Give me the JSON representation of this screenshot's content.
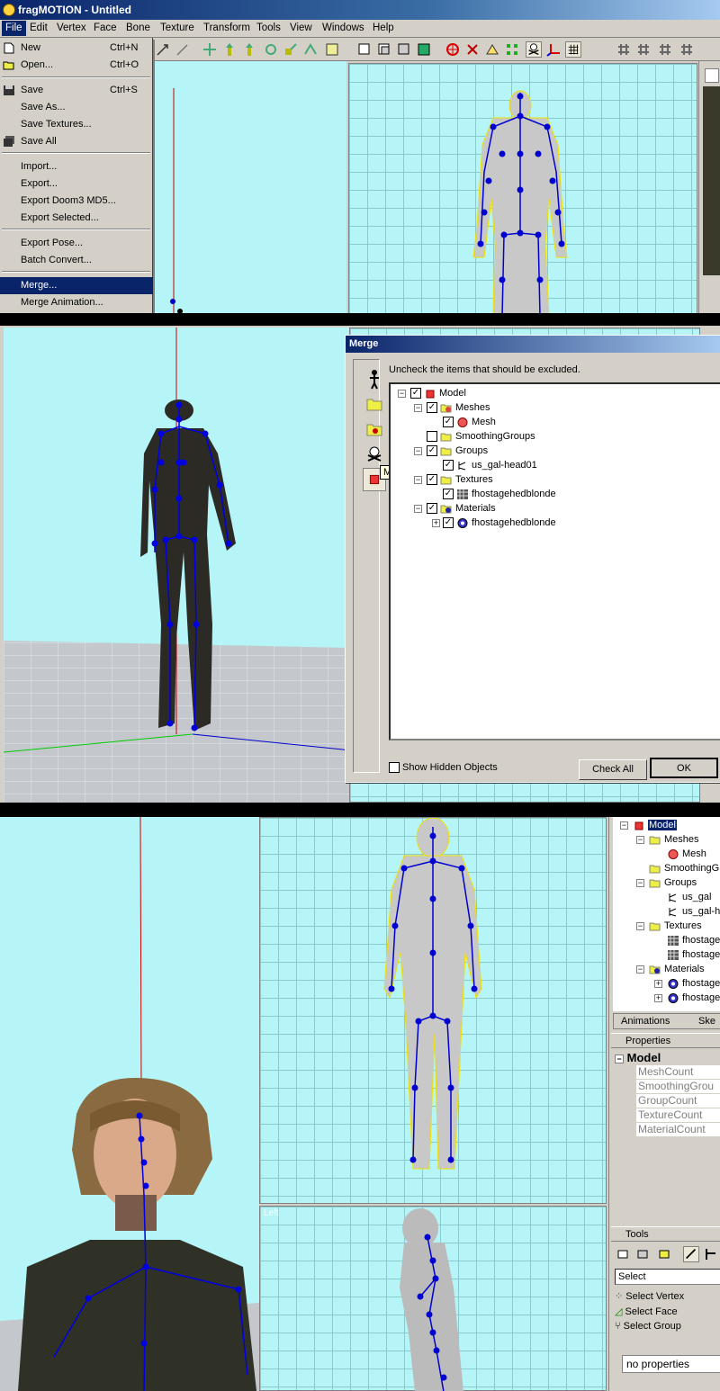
{
  "window": {
    "title": "fragMOTION - Untitled"
  },
  "menu": {
    "items": [
      "File",
      "Edit",
      "Vertex",
      "Face",
      "Bone",
      "Texture",
      "Transform",
      "Tools",
      "View",
      "Windows",
      "Help"
    ]
  },
  "file_menu": {
    "new": {
      "label": "New",
      "shortcut": "Ctrl+N"
    },
    "open": {
      "label": "Open...",
      "shortcut": "Ctrl+O"
    },
    "save": {
      "label": "Save",
      "shortcut": "Ctrl+S"
    },
    "save_as": {
      "label": "Save As..."
    },
    "save_textures": {
      "label": "Save Textures..."
    },
    "save_all": {
      "label": "Save All"
    },
    "import": {
      "label": "Import..."
    },
    "export": {
      "label": "Export..."
    },
    "export_doom3": {
      "label": "Export Doom3 MD5..."
    },
    "export_selected": {
      "label": "Export Selected..."
    },
    "export_pose": {
      "label": "Export Pose..."
    },
    "batch_convert": {
      "label": "Batch Convert..."
    },
    "merge": {
      "label": "Merge..."
    },
    "merge_animation": {
      "label": "Merge Animation..."
    }
  },
  "viewports": {
    "left_label": "Left"
  },
  "merge_dialog": {
    "title": "Merge",
    "instruction": "Uncheck the items that should be excluded.",
    "tooltip": "Model",
    "tree": {
      "model": "Model",
      "meshes": "Meshes",
      "mesh": "Mesh",
      "smoothing_groups": "SmoothingGroups",
      "groups": "Groups",
      "group_item": "us_gal-head01",
      "textures": "Textures",
      "texture_item": "fhostagehedblonde",
      "materials": "Materials",
      "material_item": "fhostagehedblonde"
    },
    "show_hidden": "Show Hidden Objects",
    "check_all": "Check All",
    "ok": "OK"
  },
  "right_panel": {
    "tree": {
      "model": "Model",
      "meshes": "Meshes",
      "mesh": "Mesh",
      "smoothing": "SmoothingG",
      "groups": "Groups",
      "group1": "us_gal",
      "group2": "us_gal-h",
      "textures": "Textures",
      "tex1": "fhostage",
      "tex2": "fhostage",
      "materials": "Materials",
      "mat1": "fhostage",
      "mat2": "fhostage"
    },
    "tabs": {
      "animations": "Animations",
      "skeleton": "Ske"
    },
    "properties": {
      "header": "Properties",
      "section": "Model",
      "rows": [
        "MeshCount",
        "SmoothingGrou",
        "GroupCount",
        "TextureCount",
        "MaterialCount"
      ]
    },
    "tools": {
      "header": "Tools",
      "mode": "Select",
      "select_vertex": "Select Vertex",
      "select_face": "Select Face",
      "select_group": "Select Group",
      "no_properties": "no properties"
    }
  }
}
